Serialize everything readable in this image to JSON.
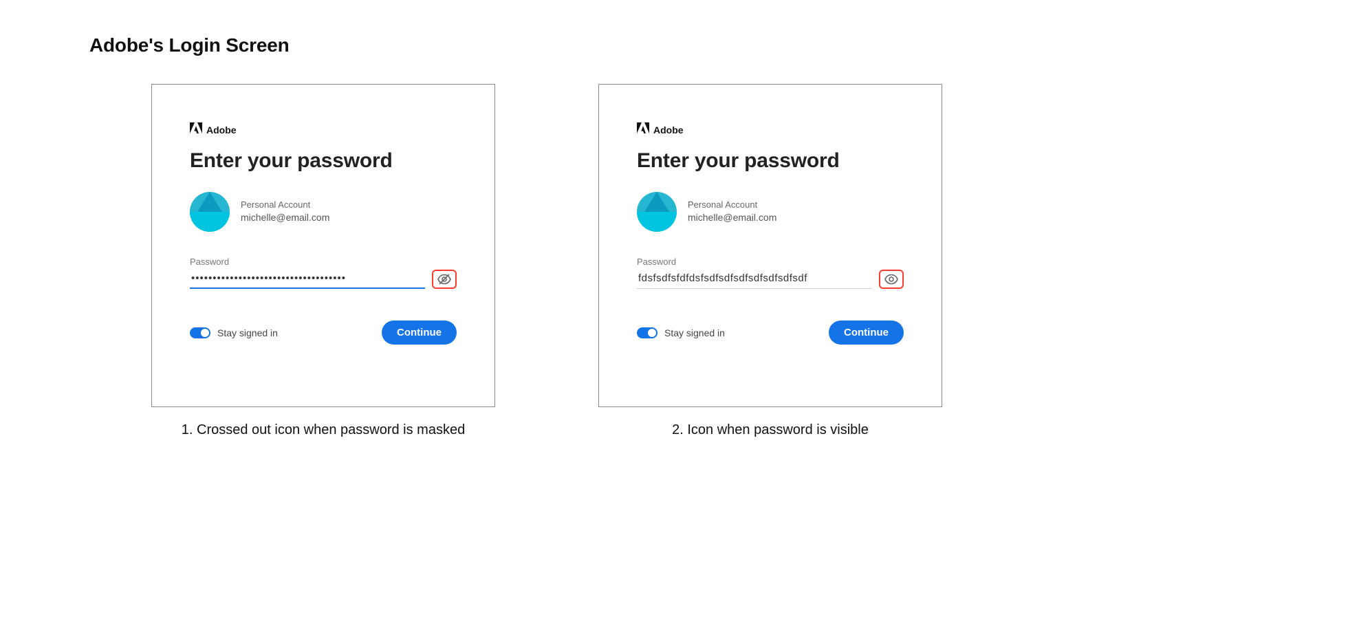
{
  "title": "Adobe's Login Screen",
  "common": {
    "brand": "Adobe",
    "heading": "Enter your password",
    "account_type": "Personal Account",
    "account_email": "michelle@email.com",
    "password_label": "Password",
    "stay_label": "Stay signed in",
    "continue_label": "Continue"
  },
  "panels": [
    {
      "password_value": "••••••••••••••••••••••••••••••••••••",
      "masked": true,
      "input_focused": true,
      "caption": "1. Crossed out icon when password is masked"
    },
    {
      "password_value": "fdsfsdfsfdfdsfsdfsdfsdfsdfsdfsdfsdf",
      "masked": false,
      "input_focused": false,
      "caption": "2. Icon when password is visible"
    }
  ]
}
